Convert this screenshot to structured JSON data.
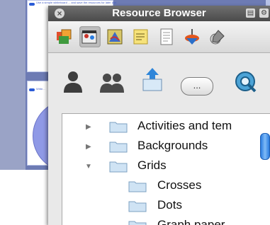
{
  "background": {
    "thumbnail_1_text": "Use a simple whiteboard ... and save the resources for later use.",
    "thumbnail_2_text": "Write..."
  },
  "panel": {
    "title": "Resource Browser",
    "toolbar_icons": [
      "gallery-icon",
      "media-icon",
      "graphics-icon",
      "notes-icon",
      "pages-icon",
      "spinner-icon",
      "pencil-icon"
    ],
    "action_icons": [
      "user-icon",
      "group-icon",
      "upload-icon",
      "more-icon",
      "search-icon"
    ],
    "ellipsis_label": "..."
  },
  "tree": [
    {
      "label": "Activities and tem",
      "expanded": false,
      "level": 0
    },
    {
      "label": "Backgrounds",
      "expanded": false,
      "level": 0
    },
    {
      "label": "Grids",
      "expanded": true,
      "level": 0
    },
    {
      "label": "Crosses",
      "level": 1
    },
    {
      "label": "Dots",
      "level": 1
    },
    {
      "label": "Graph paper",
      "level": 1
    }
  ],
  "colors": {
    "titlebar": "#5a5a5a",
    "selected_toolbar": "#bdbdbd",
    "scroll_thumb": "#2b7de0"
  }
}
